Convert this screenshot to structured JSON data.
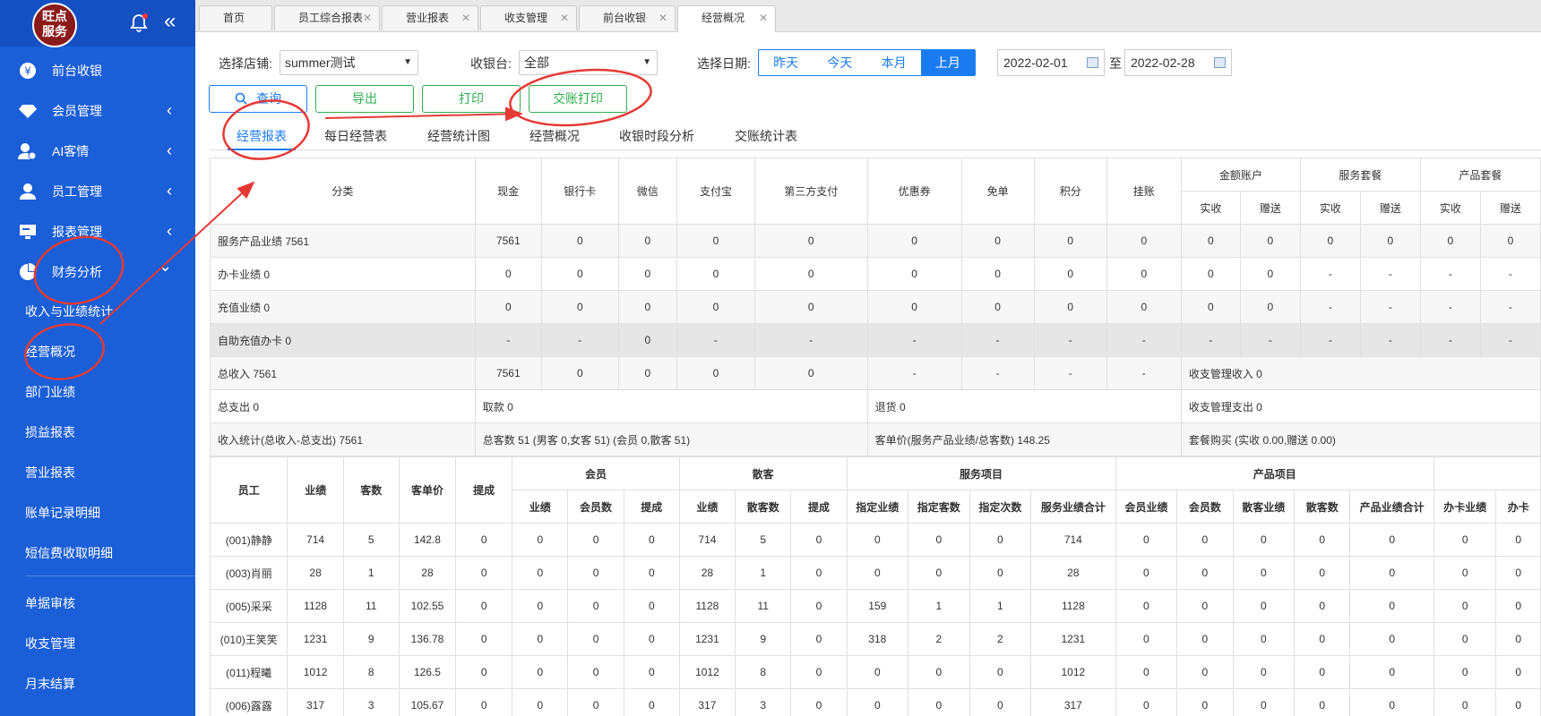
{
  "logo": {
    "line1": "旺点",
    "line2": "服务"
  },
  "sidebar": {
    "items": [
      {
        "label": "前台收银",
        "icon": "yen-icon",
        "arrow": ""
      },
      {
        "label": "会员管理",
        "icon": "diamond-icon",
        "arrow": "‹"
      },
      {
        "label": "AI客情",
        "icon": "user-add-icon",
        "arrow": "‹"
      },
      {
        "label": "员工管理",
        "icon": "user-icon",
        "arrow": "‹"
      },
      {
        "label": "报表管理",
        "icon": "monitor-icon",
        "arrow": "‹"
      },
      {
        "label": "财务分析",
        "icon": "pie-chart-icon",
        "arrow": "⌄"
      }
    ],
    "subitems": [
      "收入与业绩统计",
      "经营概况",
      "部门业绩",
      "损益报表",
      "营业报表",
      "账单记录明细",
      "短信费收取明细"
    ],
    "bottom": [
      "单据审核",
      "收支管理",
      "月末结算"
    ]
  },
  "tabs": [
    "首页",
    "员工综合报表",
    "营业报表",
    "收支管理",
    "前台收银",
    "经营概况"
  ],
  "filters": {
    "store_label": "选择店铺:",
    "store_value": "summer测试",
    "register_label": "收银台:",
    "register_value": "全部",
    "date_label": "选择日期:",
    "ranges": [
      "昨天",
      "今天",
      "本月",
      "上月"
    ],
    "from": "2022-02-01",
    "to_label": "至",
    "to": "2022-02-28"
  },
  "buttons": {
    "query": "查询",
    "export": "导出",
    "print": "打印",
    "shift_print": "交账打印"
  },
  "report_tabs": [
    "经营报表",
    "每日经营表",
    "经营统计图",
    "经营概况",
    "收银时段分析",
    "交账统计表"
  ],
  "table1": {
    "head_category": "分类",
    "heads": [
      "现金",
      "银行卡",
      "微信",
      "支付宝",
      "第三方支付",
      "优惠券",
      "免单",
      "积分",
      "挂账"
    ],
    "groups": [
      "金额账户",
      "服务套餐",
      "产品套餐"
    ],
    "sub": [
      "实收",
      "赠送",
      "实收",
      "赠送",
      "实收",
      "赠送"
    ],
    "rows": [
      {
        "label": "服务产品业绩 7561",
        "cells": [
          "7561",
          "0",
          "0",
          "0",
          "0",
          "0",
          "0",
          "0",
          "0",
          "0",
          "0",
          "0",
          "0",
          "0",
          "0"
        ]
      },
      {
        "label": "办卡业绩 0",
        "cells": [
          "0",
          "0",
          "0",
          "0",
          "0",
          "0",
          "0",
          "0",
          "0",
          "0",
          "0",
          "-",
          "-",
          "-",
          "-"
        ]
      },
      {
        "label": "充值业绩 0",
        "cells": [
          "0",
          "0",
          "0",
          "0",
          "0",
          "0",
          "0",
          "0",
          "0",
          "0",
          "0",
          "-",
          "-",
          "-",
          "-"
        ]
      },
      {
        "label": "自助充值办卡 0",
        "cells": [
          "-",
          "-",
          "0",
          "-",
          "-",
          "-",
          "-",
          "-",
          "-",
          "-",
          "-",
          "-",
          "-",
          "-",
          "-"
        ]
      },
      {
        "label": "总收入 7561",
        "cells": [
          "7561",
          "0",
          "0",
          "0",
          "0",
          "-",
          "-",
          "-",
          "-"
        ],
        "tail": "收支管理收入 0"
      }
    ],
    "sum_rows": [
      [
        "总支出 0",
        "取款 0",
        "退货 0",
        "收支管理支出 0"
      ],
      [
        "收入统计(总收入-总支出) 7561",
        "总客数 51 (男客 0,女客 51) (会员 0,散客 51)",
        "客单价(服务产品业绩/总客数) 148.25",
        "套餐购买 (实收 0.00,赠送 0.00)"
      ]
    ]
  },
  "table2": {
    "heads": [
      "员工",
      "业绩",
      "客数",
      "客单价",
      "提成"
    ],
    "groups": [
      "会员",
      "散客",
      "服务项目",
      "产品项目"
    ],
    "sub": [
      "业绩",
      "会员数",
      "提成",
      "业绩",
      "散客数",
      "提成",
      "指定业绩",
      "指定客数",
      "指定次数",
      "服务业绩合计",
      "会员业绩",
      "会员数",
      "散客业绩",
      "散客数",
      "产品业绩合计",
      "办卡业绩",
      "办卡"
    ],
    "rows": [
      [
        "(001)静静",
        "714",
        "5",
        "142.8",
        "0",
        "0",
        "0",
        "0",
        "714",
        "5",
        "0",
        "0",
        "0",
        "0",
        "714",
        "0",
        "0",
        "0",
        "0",
        "0",
        "0",
        "0"
      ],
      [
        "(003)肖丽",
        "28",
        "1",
        "28",
        "0",
        "0",
        "0",
        "0",
        "28",
        "1",
        "0",
        "0",
        "0",
        "0",
        "28",
        "0",
        "0",
        "0",
        "0",
        "0",
        "0",
        "0"
      ],
      [
        "(005)采采",
        "1128",
        "11",
        "102.55",
        "0",
        "0",
        "0",
        "0",
        "1128",
        "11",
        "0",
        "159",
        "1",
        "1",
        "1128",
        "0",
        "0",
        "0",
        "0",
        "0",
        "0",
        "0"
      ],
      [
        "(010)王笑笑",
        "1231",
        "9",
        "136.78",
        "0",
        "0",
        "0",
        "0",
        "1231",
        "9",
        "0",
        "318",
        "2",
        "2",
        "1231",
        "0",
        "0",
        "0",
        "0",
        "0",
        "0",
        "0"
      ],
      [
        "(011)程曦",
        "1012",
        "8",
        "126.5",
        "0",
        "0",
        "0",
        "0",
        "1012",
        "8",
        "0",
        "0",
        "0",
        "0",
        "1012",
        "0",
        "0",
        "0",
        "0",
        "0",
        "0",
        "0"
      ],
      [
        "(006)露露",
        "317",
        "3",
        "105.67",
        "0",
        "0",
        "0",
        "0",
        "317",
        "3",
        "0",
        "0",
        "0",
        "0",
        "317",
        "0",
        "0",
        "0",
        "0",
        "0",
        "0",
        "0"
      ]
    ]
  },
  "colors": {
    "sidebar": "#1a5fd8",
    "accent": "#1a7cf0",
    "green": "#2fae4e",
    "annotation": "#e53935"
  }
}
